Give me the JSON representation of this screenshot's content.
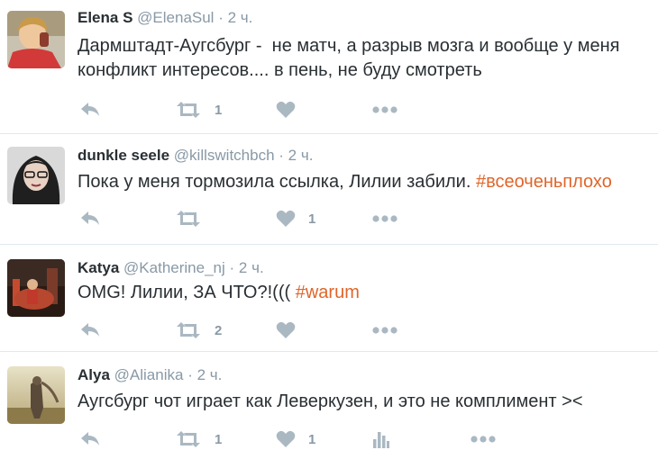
{
  "tweets": [
    {
      "name": "Elena S",
      "handle": "@ElenaSul",
      "time": "2 ч.",
      "text": "Дармштадт-Аугсбург -  не матч, а разрыв мозга и вообще у меня\nконфликт интересов.... в пень, не буду смотреть",
      "hashtag": "",
      "retweets": "1",
      "likes": ""
    },
    {
      "name": "dunkle seele",
      "handle": "@killswitchbch",
      "time": "2 ч.",
      "text": "Пока у меня тормозила ссылка, Лилии забили. ",
      "hashtag": "#всеоченьплохо",
      "retweets": "",
      "likes": "1"
    },
    {
      "name": "Katya",
      "handle": "@Katherine_nj",
      "time": "2 ч.",
      "text": "OMG! Лилии, ЗА ЧТО?!((( ",
      "hashtag": "#warum",
      "retweets": "2",
      "likes": ""
    },
    {
      "name": "Alya",
      "handle": "@Alianika",
      "time": "2 ч.",
      "text": "Аугсбург чот играет как Леверкузен, и это не комплимент ><",
      "hashtag": "",
      "retweets": "1",
      "likes": "1"
    }
  ],
  "separator": "·",
  "colors": {
    "hashtag": "#e0652a",
    "meta": "#8899a6",
    "icon": "#aab8c2"
  },
  "icons": [
    "reply-icon",
    "retweet-icon",
    "like-icon",
    "analytics-icon",
    "more-icon"
  ]
}
